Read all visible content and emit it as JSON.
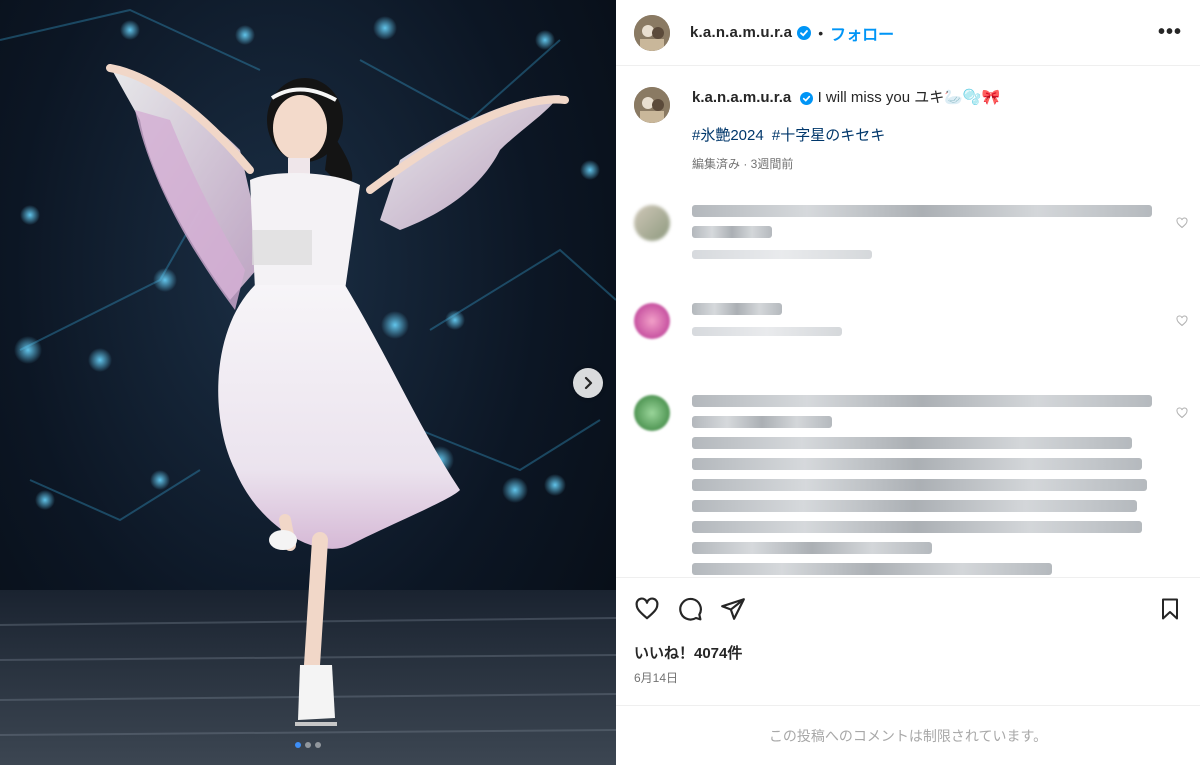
{
  "post": {
    "username": "k.a.n.a.m.u.r.a",
    "follow_label": "フォロー",
    "separator": "•",
    "more_label": "•••"
  },
  "caption": {
    "username": "k.a.n.a.m.u.r.a",
    "text": "I will miss you ユキ🦢🫧🎀",
    "hashtags": [
      "#氷艶2024",
      "#十字星のキセキ"
    ],
    "meta": "編集済み · 3週間前"
  },
  "comments": [
    {
      "name": "blurred-comment-1"
    },
    {
      "name": "blurred-comment-2"
    },
    {
      "name": "blurred-comment-3"
    }
  ],
  "actions": {
    "likes": "いいね！4074件",
    "date": "6月14日"
  },
  "footer": {
    "restricted": "この投稿へのコメントは制限されています。"
  },
  "icons": [
    "verified-badge-icon",
    "more-options-icon",
    "heart-icon",
    "comment-icon",
    "share-icon",
    "bookmark-icon",
    "chevron-right-icon"
  ],
  "colors": {
    "accent": "#0095f6",
    "hashtag": "#00376b",
    "muted": "#737373",
    "verified": "#0095f6"
  }
}
